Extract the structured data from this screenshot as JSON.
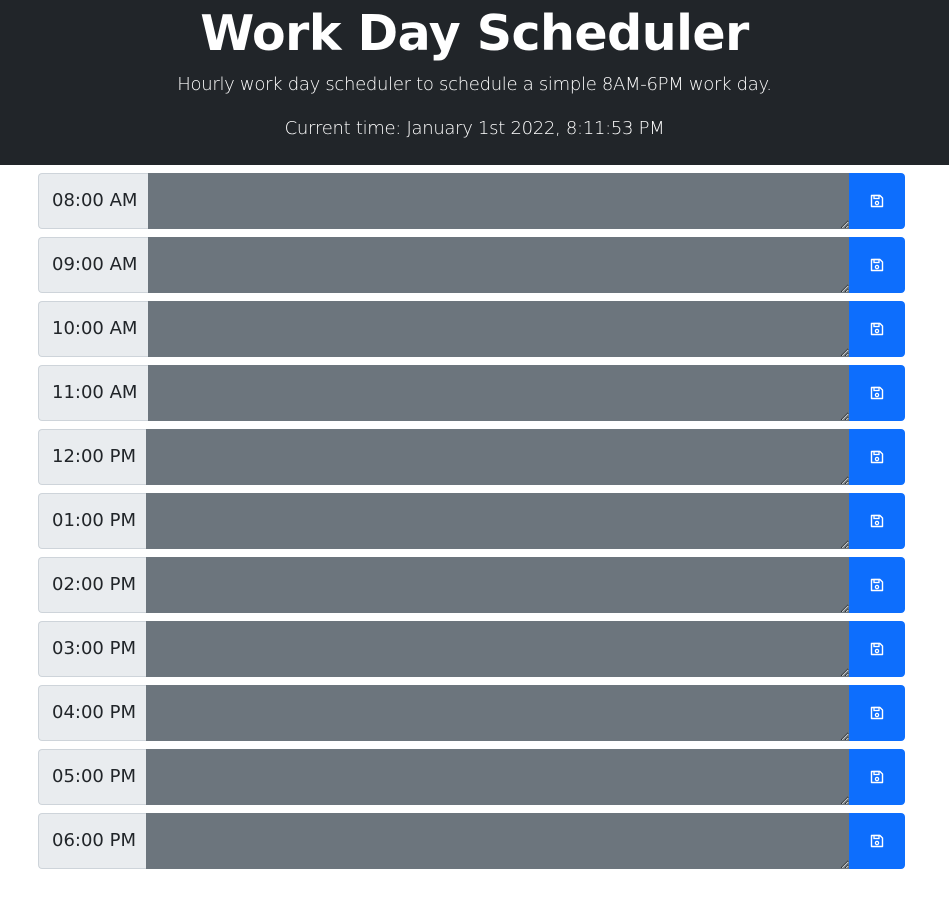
{
  "header": {
    "title": "Work Day Scheduler",
    "subtitle": "Hourly work day scheduler to schedule a simple 8AM-6PM work day.",
    "current_time": "Current time: January 1st 2022, 8:11:53 PM"
  },
  "colors": {
    "header_bg": "#212529",
    "past_block": "#6c757d",
    "save_button": "#0d6efd",
    "hour_label_bg": "#e9ecef"
  },
  "schedule": {
    "save_icon": "floppy-disk-icon",
    "rows": [
      {
        "hour": "08:00 AM",
        "task": ""
      },
      {
        "hour": "09:00 AM",
        "task": ""
      },
      {
        "hour": "10:00 AM",
        "task": ""
      },
      {
        "hour": "11:00 AM",
        "task": ""
      },
      {
        "hour": "12:00 PM",
        "task": ""
      },
      {
        "hour": "01:00 PM",
        "task": ""
      },
      {
        "hour": "02:00 PM",
        "task": ""
      },
      {
        "hour": "03:00 PM",
        "task": ""
      },
      {
        "hour": "04:00 PM",
        "task": ""
      },
      {
        "hour": "05:00 PM",
        "task": ""
      },
      {
        "hour": "06:00 PM",
        "task": ""
      }
    ]
  }
}
